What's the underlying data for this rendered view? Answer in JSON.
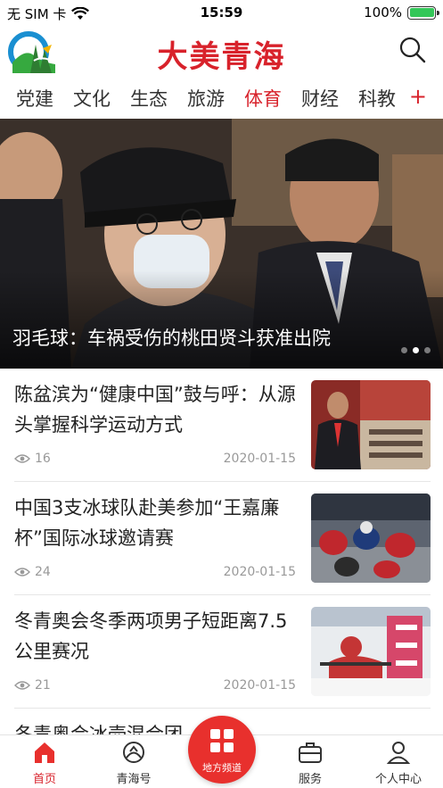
{
  "status_bar": {
    "carrier": "无 SIM 卡",
    "time": "15:59",
    "battery_percent": "100%"
  },
  "header": {
    "brand": "大美青海"
  },
  "channels": {
    "tabs": [
      "党建",
      "文化",
      "生态",
      "旅游",
      "体育",
      "财经",
      "科教"
    ],
    "active": "体育",
    "add_symbol": "+"
  },
  "hero": {
    "title": "羽毛球：车祸受伤的桃田贤斗获准出院",
    "slide_count": 3,
    "active_slide": 2
  },
  "news": [
    {
      "title": "陈盆滨为“健康中国”鼓与呼：从源头掌握科学运动方式",
      "views": "16",
      "date": "2020-01-15"
    },
    {
      "title": "中国3支冰球队赴美参加“王嘉廉杯”国际冰球邀请赛",
      "views": "24",
      "date": "2020-01-15"
    },
    {
      "title": "冬青奥会冬季两项男子短距离7.5公里赛况",
      "views": "21",
      "date": "2020-01-15"
    },
    {
      "title": "冬青奥会冰壶混合团…中"
    }
  ],
  "bottom_nav": {
    "home": "首页",
    "qinghai_hao": "青海号",
    "local_channel": "地方频道",
    "services": "服务",
    "profile": "个人中心"
  },
  "colors": {
    "brand_red": "#d8222b",
    "center_button": "#e8302d",
    "battery_green": "#34c759"
  }
}
